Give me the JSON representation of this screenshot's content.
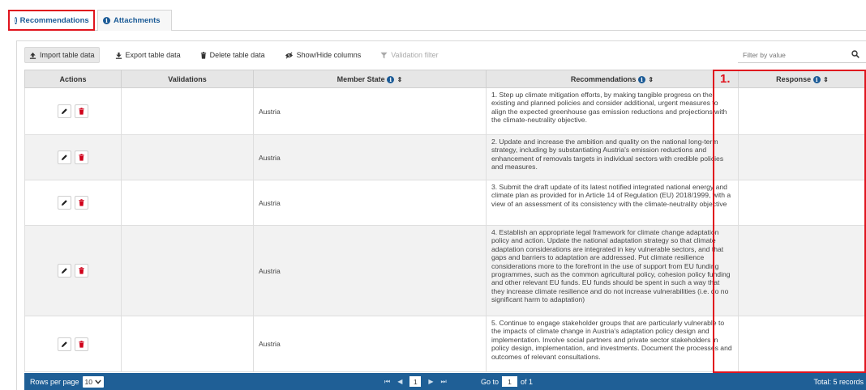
{
  "tabs": [
    {
      "label": "Recommendations",
      "active": true
    },
    {
      "label": "Attachments",
      "active": false
    }
  ],
  "toolbar": {
    "import_label": "Import table data",
    "export_label": "Export table data",
    "delete_label": "Delete table data",
    "showhide_label": "Show/Hide columns",
    "validation_label": "Validation filter"
  },
  "filter": {
    "placeholder": "Filter by value"
  },
  "table": {
    "headers": {
      "actions": "Actions",
      "validations": "Validations",
      "member_state": "Member State",
      "recommendations": "Recommendations",
      "response": "Response"
    },
    "rows": [
      {
        "member_state": "Austria",
        "recommendation": "1. Step up climate mitigation efforts, by making tangible progress on the existing and planned policies and consider additional, urgent measures to align the expected greenhouse gas emission reductions and projections with the climate-neutrality objective.",
        "response": ""
      },
      {
        "member_state": "Austria",
        "recommendation": "2. Update and increase the ambition and quality on the national long-term strategy, including by substantiating Austria's emission reductions and enhancement of removals targets in individual sectors with credible policies and measures.",
        "response": ""
      },
      {
        "member_state": "Austria",
        "recommendation": "3. Submit the draft update of its latest notified integrated national energy and climate plan as provided for in Article 14 of Regulation (EU) 2018/1999, with a view of an assessment of its consistency with the climate-neutrality objective",
        "response": ""
      },
      {
        "member_state": "Austria",
        "recommendation": "4. Establish an appropriate legal framework for climate change adaptation policy and action. Update the national adaptation strategy so that climate adaptation considerations are integrated in key vulnerable sectors, and that gaps and barriers to adaptation are addressed. Put climate resilience considerations more to the forefront in the use of support from EU funding programmes, such as the common agricultural policy, cohesion policy funding and other relevant EU funds. EU funds should be spent in such a way that they increase climate resilience and do not increase vulnerabilities (i.e. do no significant harm to adaptation)",
        "response": ""
      },
      {
        "member_state": "Austria",
        "recommendation": "5. Continue to engage stakeholder groups that are particularly vulnerable to the impacts of climate change in Austria's adaptation policy design and implementation. Involve social partners and private sector stakeholders in policy design, implementation, and investments. Document the processes and outcomes of relevant consultations.",
        "response": ""
      }
    ]
  },
  "annotation": {
    "label": "1."
  },
  "footer": {
    "rows_per_page_label": "Rows per page",
    "rows_per_page_value": "10",
    "current_page": "1",
    "goto_label": "Go to",
    "goto_value": "1",
    "of_label": "of 1",
    "total_label": "Total: 5 records"
  },
  "colors": {
    "accent_blue": "#1f5f96",
    "highlight_red": "#e0141e",
    "delete_red": "#d0021b"
  }
}
